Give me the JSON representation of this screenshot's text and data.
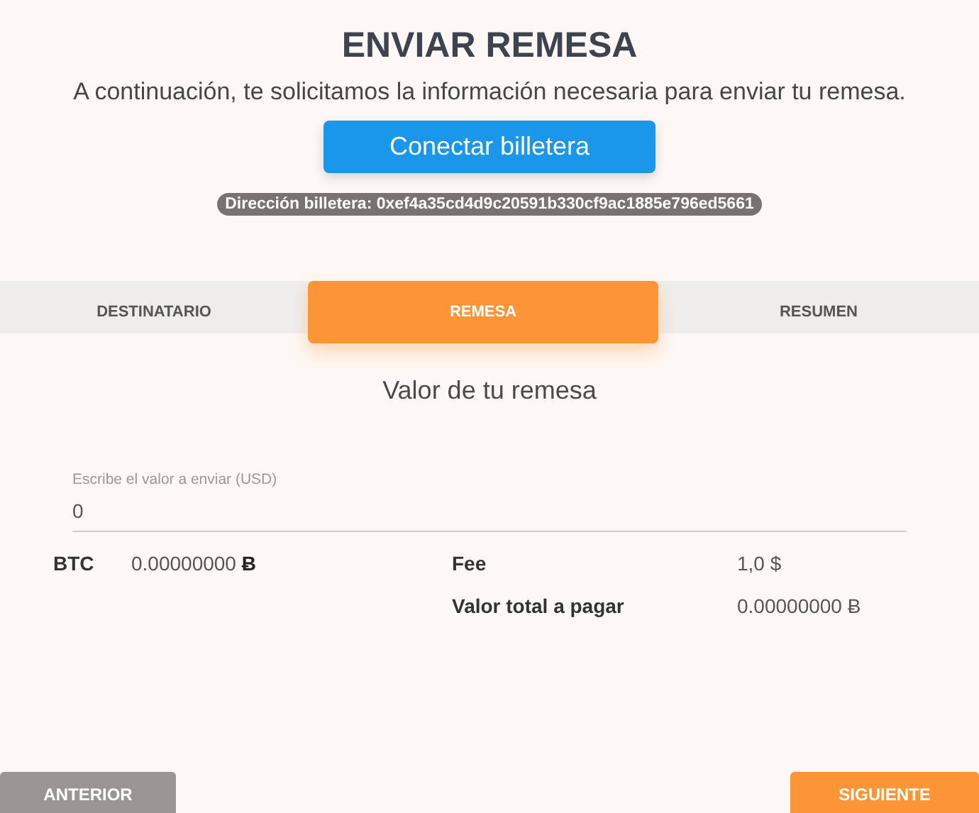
{
  "title": "ENVIAR REMESA",
  "subtitle": "A continuación, te solicitamos la información necesaria para enviar tu remesa.",
  "connect_button": "Conectar billetera",
  "wallet_address": "Dirección billetera: 0xef4a35cd4d9c20591b330cf9ac1885e796ed5661",
  "steps": [
    {
      "label": "DESTINATARIO",
      "selected": false
    },
    {
      "label": "REMESA",
      "selected": true
    },
    {
      "label": "RESUMEN",
      "selected": false
    }
  ],
  "section_title": "Valor de tu remesa",
  "amount_field": {
    "label": "Escribe el valor a enviar (USD)",
    "value": "0"
  },
  "btc": {
    "label": "BTC",
    "value": "0.00000000",
    "symbol": "Ƀ"
  },
  "fee": {
    "label": "Fee",
    "value": "1,0 $"
  },
  "total": {
    "label": "Valor total a pagar",
    "value": "0.00000000 Ƀ"
  },
  "back_button": "ANTERIOR",
  "next_button": "SIGUIENTE"
}
